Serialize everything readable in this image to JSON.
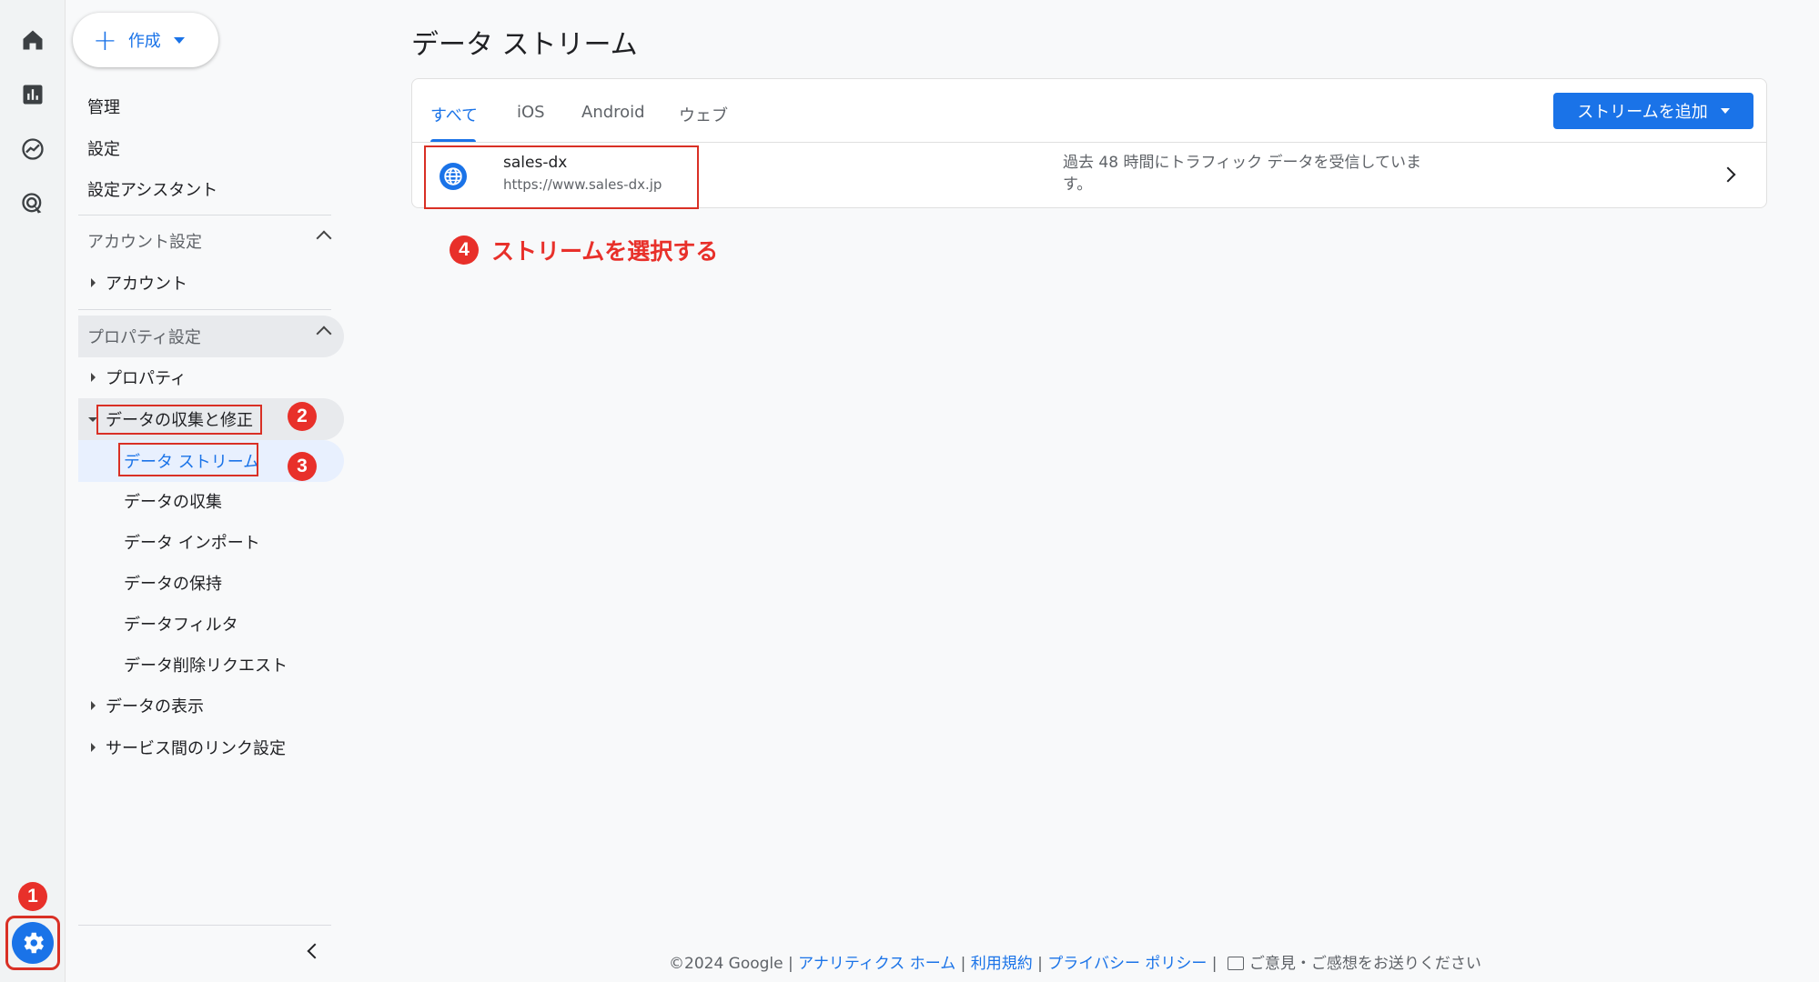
{
  "rail": {
    "icons": [
      "home-icon",
      "reports-icon",
      "explore-icon",
      "advertising-icon",
      "admin-gear-icon"
    ]
  },
  "annotations": {
    "badge1": "1",
    "badge2": "2",
    "badge3": "3",
    "badge4": "4",
    "step4_text": "ストリームを選択する"
  },
  "sidebar": {
    "create_label": "作成",
    "top_items": [
      "管理",
      "設定",
      "設定アシスタント"
    ],
    "account_section": "アカウント設定",
    "account_item": "アカウント",
    "property_section": "プロパティ設定",
    "property_item": "プロパティ",
    "data_collection": "データの収集と修正",
    "sub_items": [
      "データ ストリーム",
      "データの収集",
      "データ インポート",
      "データの保持",
      "データフィルタ",
      "データ削除リクエスト"
    ],
    "data_display": "データの表示",
    "product_links": "サービス間のリンク設定"
  },
  "main": {
    "title": "データ ストリーム",
    "tabs": [
      "すべて",
      "iOS",
      "Android",
      "ウェブ"
    ],
    "add_stream_label": "ストリームを追加",
    "stream": {
      "name": "sales-dx",
      "url": "https://www.sales-dx.jp",
      "status": "過去 48 時間にトラフィック データを受信していま す。"
    }
  },
  "footer": {
    "copyright": "©2024 Google",
    "links": [
      "アナリティクス ホーム",
      "利用規約",
      "プライバシー ポリシー"
    ],
    "feedback": "ご意見・ご感想をお送りください"
  },
  "colors": {
    "accent": "#1a73e8",
    "annotation_red": "#e8302a"
  }
}
